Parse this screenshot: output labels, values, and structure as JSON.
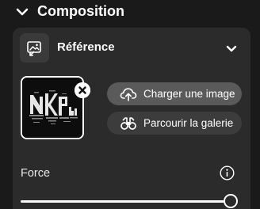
{
  "section": {
    "title": "Composition",
    "expanded": true
  },
  "reference": {
    "label": "Référence",
    "expanded": true,
    "thumbnail_alt": "image de référence"
  },
  "buttons": {
    "upload_label": "Charger une image",
    "browse_label": "Parcourir la galerie"
  },
  "force": {
    "label": "Force",
    "value_fraction": 1.0
  },
  "icons": {
    "section_toggle": "chevron-down-icon",
    "reference": "image-reference-icon",
    "reference_toggle": "chevron-down-icon",
    "remove": "close-icon",
    "upload": "cloud-upload-icon",
    "browse": "binoculars-icon",
    "info": "info-icon"
  },
  "colors": {
    "background": "#1a1a1a",
    "panel": "#2b2b2b",
    "upload_button": "#5a5a5a",
    "browse_button": "#3c3c3c",
    "text": "#ffffff"
  }
}
